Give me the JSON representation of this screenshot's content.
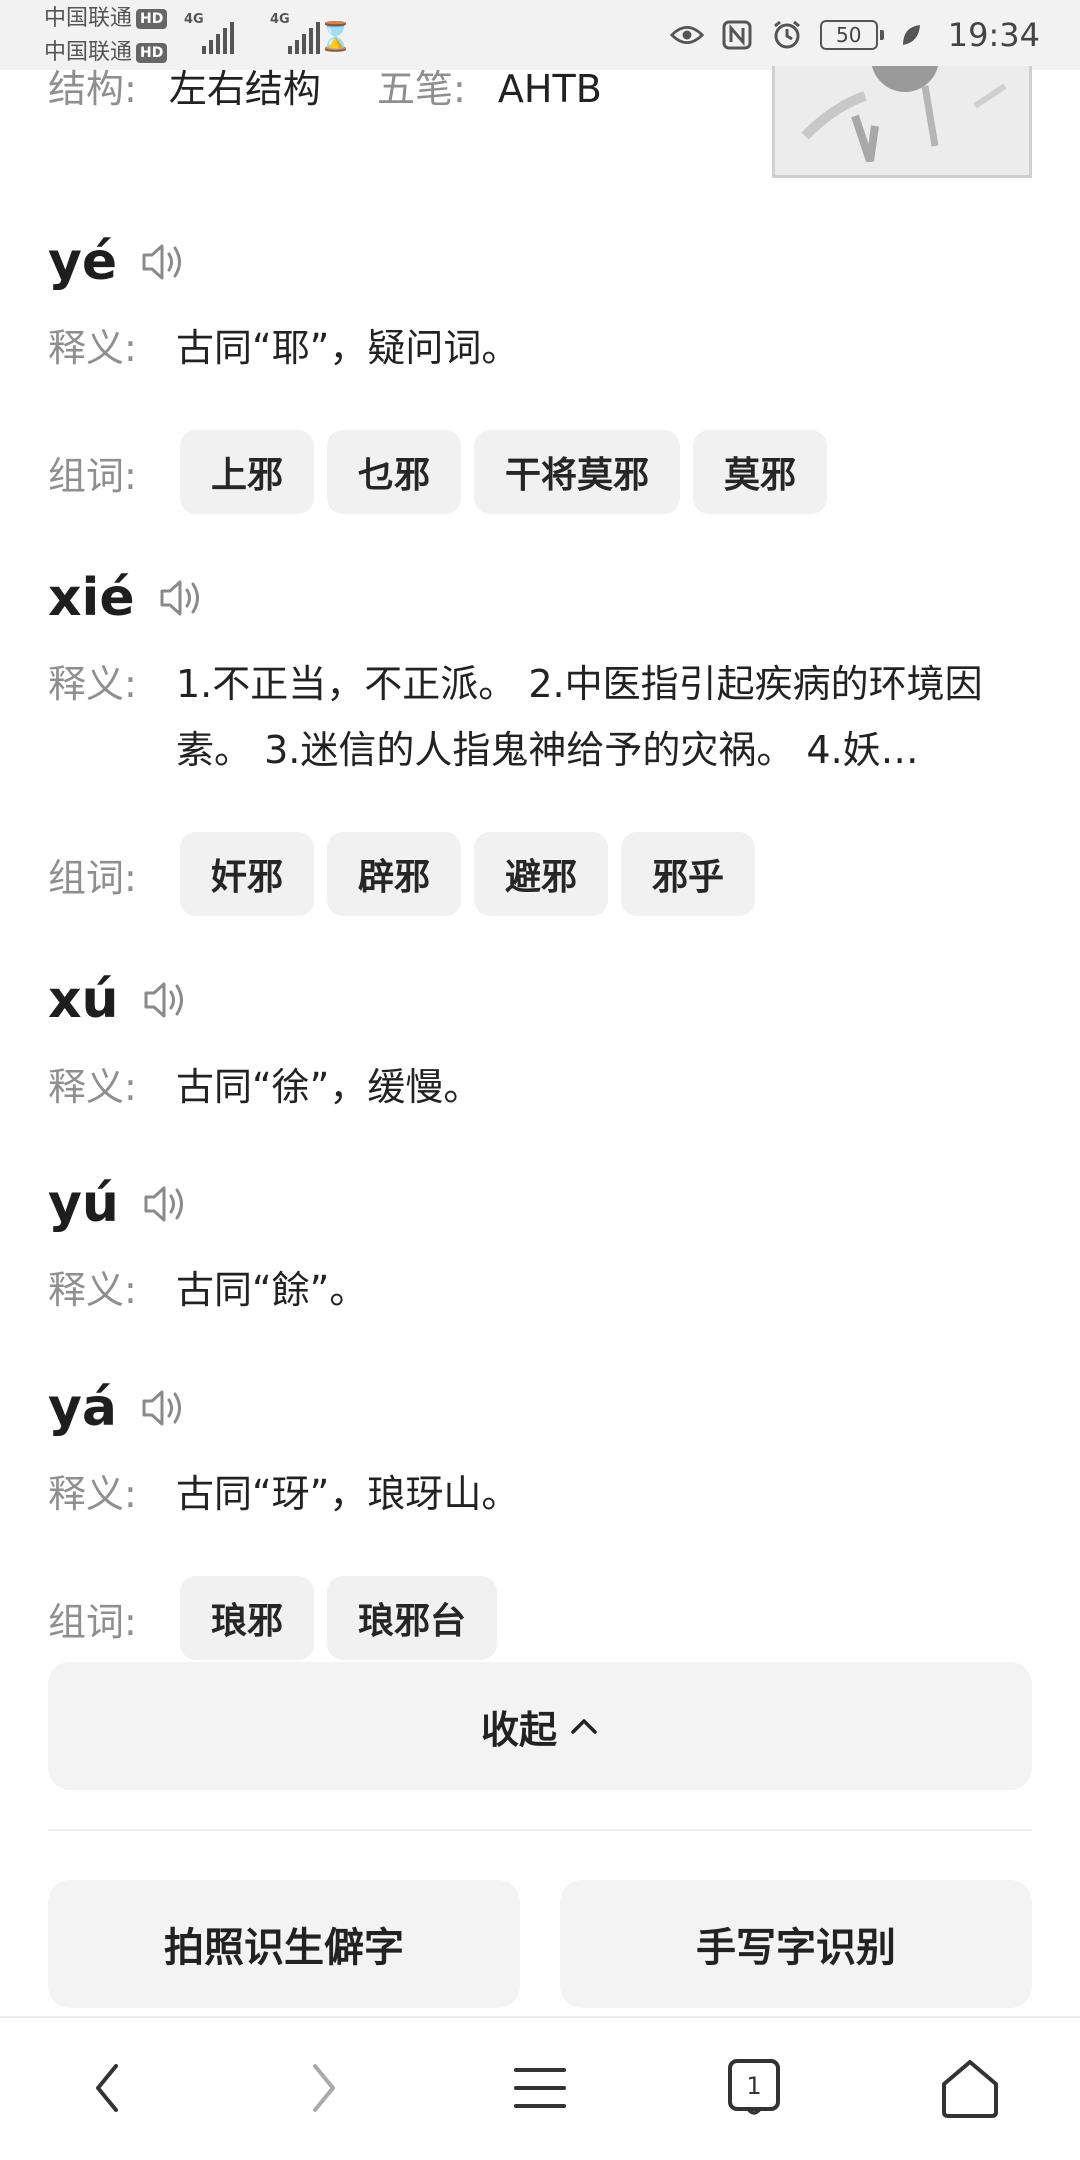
{
  "status_bar": {
    "carrier1": "中国联通",
    "carrier2": "中国联通",
    "hd": "HD",
    "network": "4G",
    "battery": "50",
    "time": "19:34"
  },
  "info": {
    "structure_label": "结构:",
    "structure_value": "左右结构",
    "wubi_label": "五笔:",
    "wubi_value": "AHTB"
  },
  "labels": {
    "definition": "释义:",
    "words": "组词:"
  },
  "entries": [
    {
      "pinyin": "yé",
      "definition": "古同“耶”，疑问词。",
      "words": [
        "上邪",
        "乜邪",
        "干将莫邪",
        "莫邪"
      ]
    },
    {
      "pinyin": "xié",
      "definition": "1.不正当，不正派。 2.中医指引起疾病的环境因素。 3.迷信的人指鬼神给予的灾祸。 4.妖…",
      "words": [
        "奸邪",
        "辟邪",
        "避邪",
        "邪乎"
      ]
    },
    {
      "pinyin": "xú",
      "definition": "古同“徐”，缓慢。"
    },
    {
      "pinyin": "yú",
      "definition": "古同“餘”。"
    },
    {
      "pinyin": "yá",
      "definition": "古同“玡”，琅玡山。",
      "words": [
        "琅邪",
        "琅邪台"
      ]
    }
  ],
  "collapse_label": "收起",
  "buttons": {
    "photo": "拍照识生僻字",
    "handwriting": "手写字识别"
  },
  "nav": {
    "tab_count": "1"
  }
}
